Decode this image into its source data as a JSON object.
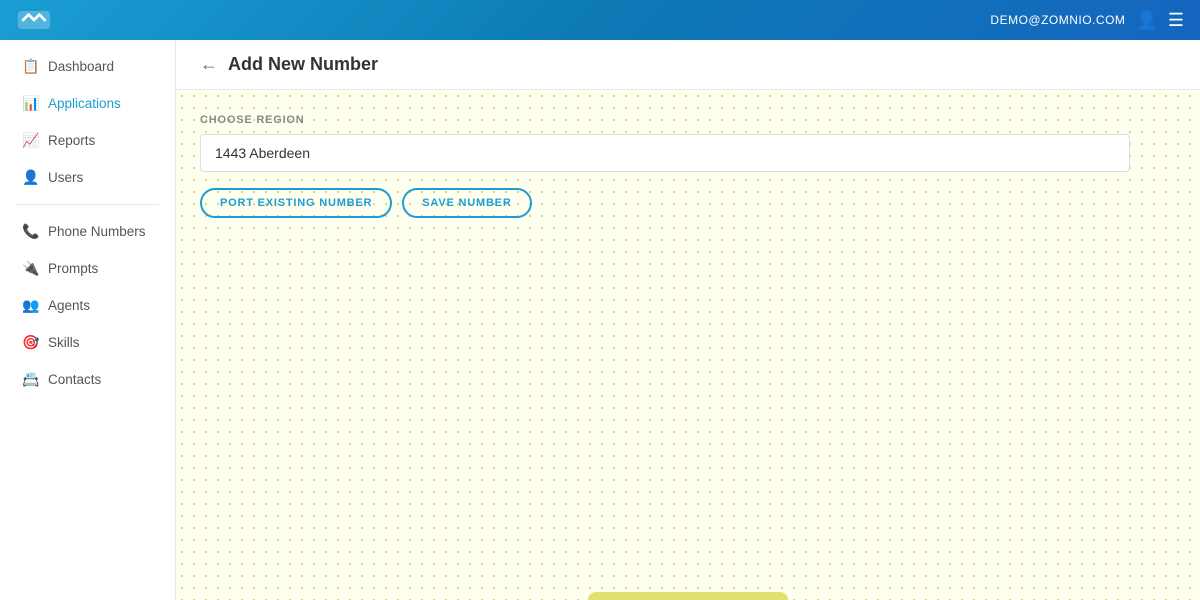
{
  "topbar": {
    "email": "DEMO@ZOMNIO.COM",
    "user_icon": "👤",
    "menu_icon": "☰"
  },
  "sidebar": {
    "items": [
      {
        "id": "dashboard",
        "label": "Dashboard",
        "icon": "📋"
      },
      {
        "id": "applications",
        "label": "Applications",
        "icon": "📊"
      },
      {
        "id": "reports",
        "label": "Reports",
        "icon": "📈"
      },
      {
        "id": "users",
        "label": "Users",
        "icon": "👤"
      },
      {
        "id": "phone-numbers",
        "label": "Phone Numbers",
        "icon": "📞"
      },
      {
        "id": "prompts",
        "label": "Prompts",
        "icon": "🔌"
      },
      {
        "id": "agents",
        "label": "Agents",
        "icon": "👥"
      },
      {
        "id": "skills",
        "label": "Skills",
        "icon": "🎯"
      },
      {
        "id": "contacts",
        "label": "Contacts",
        "icon": "📇"
      }
    ],
    "divider_after": [
      3
    ]
  },
  "page": {
    "title": "Add New Number",
    "back_label": "←"
  },
  "form": {
    "region_label": "CHOOSE REGION",
    "region_value": "1443 Aberdeen",
    "region_placeholder": "1443 Aberdeen",
    "btn_port": "PORT EXISTING NUMBER",
    "btn_save": "SAVE NUMBER"
  }
}
